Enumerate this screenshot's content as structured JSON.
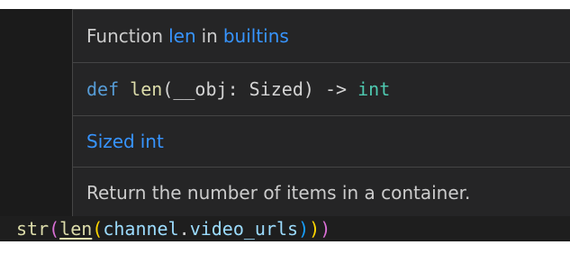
{
  "hover": {
    "title": {
      "prefix": "Function",
      "name": "len",
      "middle": "in",
      "module": "builtins"
    },
    "signature": {
      "keyword": "def",
      "func": "len",
      "open": "(",
      "param": "__obj",
      "colon": ":",
      "param_type": "Sized",
      "close": ")",
      "arrow": "->",
      "return_type": "int"
    },
    "types": [
      "Sized",
      "int"
    ],
    "doc": "Return the number of items in a container."
  },
  "code": {
    "outer_func": "str",
    "open1": "(",
    "inner_func": "len",
    "open2": "(",
    "object": "channel",
    "dot": ".",
    "attribute": "video_urls",
    "close2": ")",
    "close1": ")",
    "close0": ")"
  },
  "colors": {
    "editor_bg": "#1e1e1e",
    "hover_bg": "#252526",
    "link": "#3794ff",
    "keyword": "#569cd6",
    "function": "#dcdcaa",
    "type": "#4ec9b0",
    "variable": "#9cdcfe",
    "bracket_1": "#da70d6",
    "bracket_2": "#ffd700",
    "bracket_3": "#179fff"
  }
}
